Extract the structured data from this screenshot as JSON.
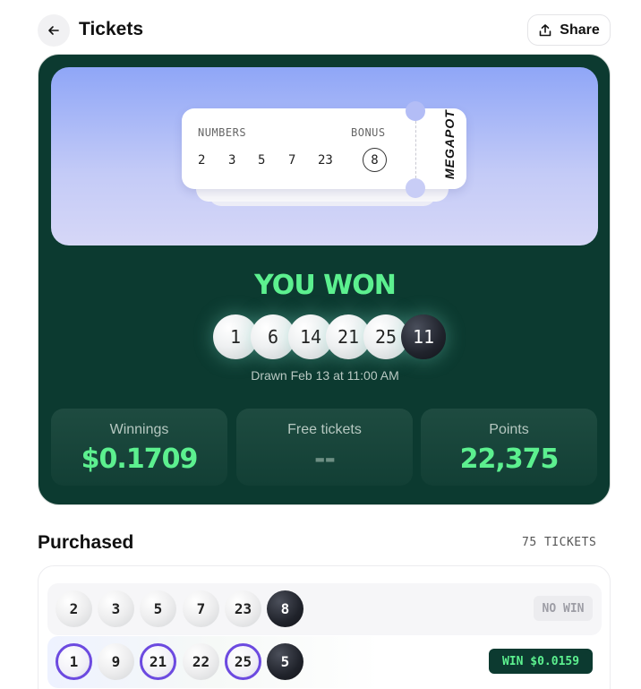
{
  "header": {
    "title": "Tickets",
    "share_label": "Share"
  },
  "hero_ticket": {
    "numbers_label": "NUMBERS",
    "bonus_label": "BONUS",
    "numbers": [
      "2",
      "3",
      "5",
      "7",
      "23"
    ],
    "bonus": "8",
    "brand": "MEGAPOT"
  },
  "result": {
    "headline": "YOU WON",
    "drawn_balls": [
      "1",
      "6",
      "14",
      "21",
      "25"
    ],
    "drawn_bonus": "11",
    "drawn_text": "Drawn Feb 13 at 11:00 AM"
  },
  "stats": [
    {
      "label": "Winnings",
      "value": "$0.1709"
    },
    {
      "label": "Free tickets",
      "value": "--"
    },
    {
      "label": "Points",
      "value": "22,375"
    }
  ],
  "purchased": {
    "title": "Purchased",
    "count_label": "75 TICKETS",
    "rows": [
      {
        "numbers": [
          "2",
          "3",
          "5",
          "7",
          "23"
        ],
        "bonus": "8",
        "result": "NO WIN"
      },
      {
        "numbers": [
          "1",
          "9",
          "21",
          "22",
          "25"
        ],
        "bonus": "5",
        "matched": [
          "1",
          "21",
          "25"
        ],
        "result": "WIN $0.0159"
      }
    ]
  },
  "colors": {
    "card_bg": "#0c3a30",
    "accent_green": "#5cf08f",
    "match_ring": "#6c4ae0"
  }
}
